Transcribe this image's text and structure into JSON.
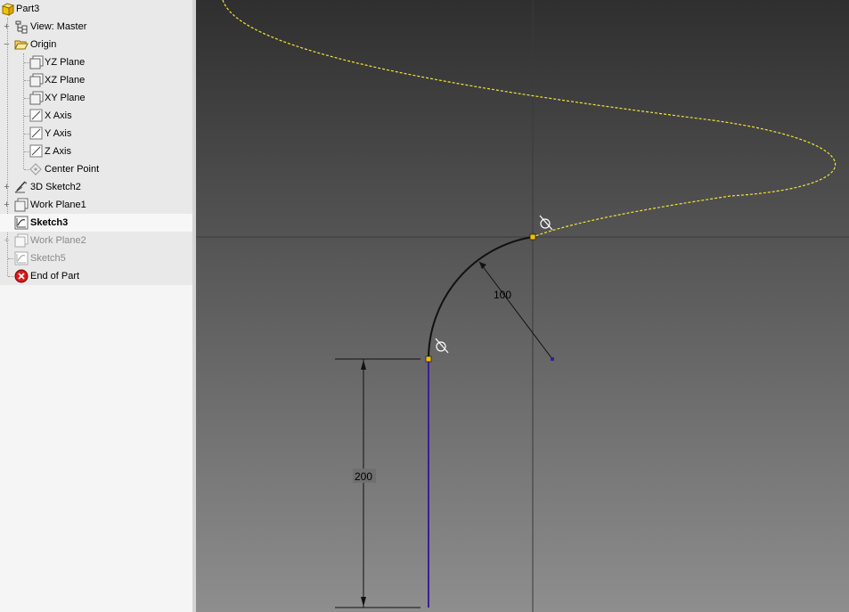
{
  "browser": {
    "part_name": "Part3",
    "view": "View: Master",
    "origin": "Origin",
    "yz_plane": "YZ Plane",
    "xz_plane": "XZ Plane",
    "xy_plane": "XY Plane",
    "x_axis": "X Axis",
    "y_axis": "Y Axis",
    "z_axis": "Z Axis",
    "center_point": "Center Point",
    "sketch_3d": "3D Sketch2",
    "work_plane1": "Work Plane1",
    "sketch3": "Sketch3",
    "work_plane2": "Work Plane2",
    "sketch5": "Sketch5",
    "end_of_part": "End of Part"
  },
  "viewport": {
    "radius_dimension": "100",
    "length_dimension": "200",
    "helix_color": "#f2e23a",
    "active_line_color": "#3b1f8f",
    "arc_color": "#111111",
    "endpoint_color": "#f5c000"
  }
}
